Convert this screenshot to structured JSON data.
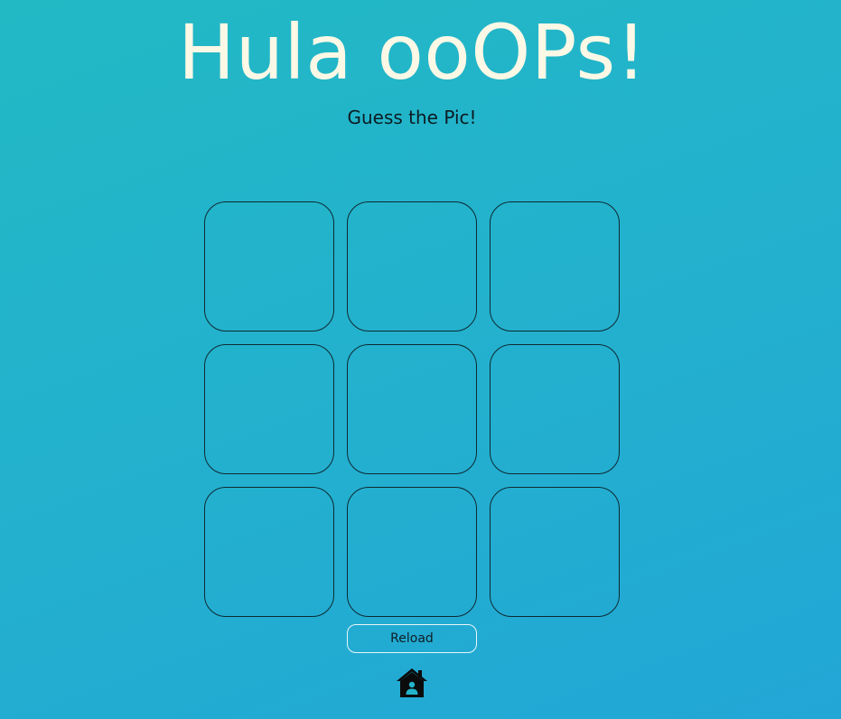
{
  "header": {
    "title": "Hula ooOPs!",
    "subtitle": "Guess the Pic!"
  },
  "board": {
    "rows": 3,
    "columns": 3,
    "tiles": [
      "",
      "",
      "",
      "",
      "",
      "",
      "",
      "",
      ""
    ]
  },
  "controls": {
    "reload_label": "Reload",
    "home_icon": "home-icon"
  },
  "colors": {
    "background_start": "#22b9c4",
    "background_end": "#22a6d6",
    "title": "#fbf8e6",
    "tile_border": "#0e2a33",
    "reload_border": "#e8f6f7"
  }
}
